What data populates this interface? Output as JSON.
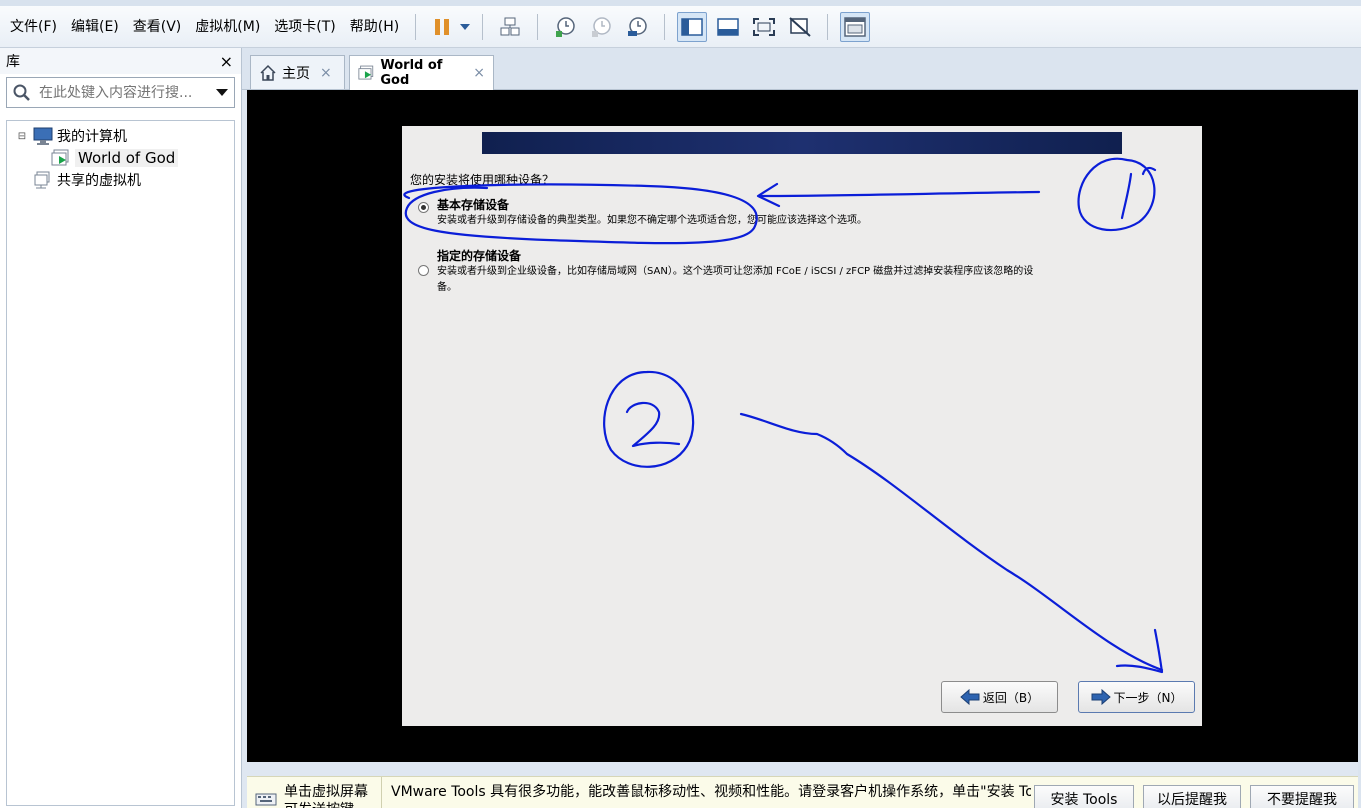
{
  "menu": {
    "items": [
      "文件(F)",
      "编辑(E)",
      "查看(V)",
      "虚拟机(M)",
      "选项卡(T)",
      "帮助(H)"
    ]
  },
  "toolbar": {
    "icons": [
      "pause-icon",
      "dropdown-arrow-icon",
      "send-ctrl-alt-del-icon",
      "snapshot-take-icon",
      "snapshot-revert-icon",
      "snapshot-manager-icon",
      "view-library-icon",
      "view-thumbnail-icon",
      "fullscreen-icon",
      "unity-icon",
      "console-view-icon"
    ]
  },
  "library": {
    "title": "库",
    "close_label": "×",
    "search_placeholder": "在此处键入内容进行搜...",
    "tree": {
      "root_expander": "⊟",
      "root": "我的计算机",
      "vm": "World of God",
      "shared": "共享的虚拟机"
    }
  },
  "tabs": [
    {
      "label": "主页",
      "close": "×"
    },
    {
      "label": "World of God",
      "close": "×"
    }
  ],
  "guest": {
    "question": "您的安装将使用哪种设备？",
    "options": [
      {
        "title": "基本存储设备",
        "desc": "安装或者升级到存储设备的典型类型。如果您不确定哪个选项适合您，您可能应该选择这个选项。",
        "selected": true
      },
      {
        "title": "指定的存储设备",
        "desc": "安装或者升级到企业级设备，比如存储局域网（SAN）。这个选项可让您添加 FCoE / iSCSI / zFCP 磁盘并过滤掉安装程序应该忽略的设备。",
        "selected": false
      }
    ],
    "back_label": "返回（B）",
    "next_label": "下一步（N）",
    "annotation_color": "#0b1ed8"
  },
  "notification": {
    "left_text": "单击虚拟屏幕可发送按键",
    "message": "VMware Tools 具有很多功能，能改善鼠标移动性、视频和性能。请登录客户机操作系统，单击\"安装 Tools\"。",
    "install_label": "安装 Tools",
    "later_label": "以后提醒我",
    "never_label": "不要提醒我"
  }
}
